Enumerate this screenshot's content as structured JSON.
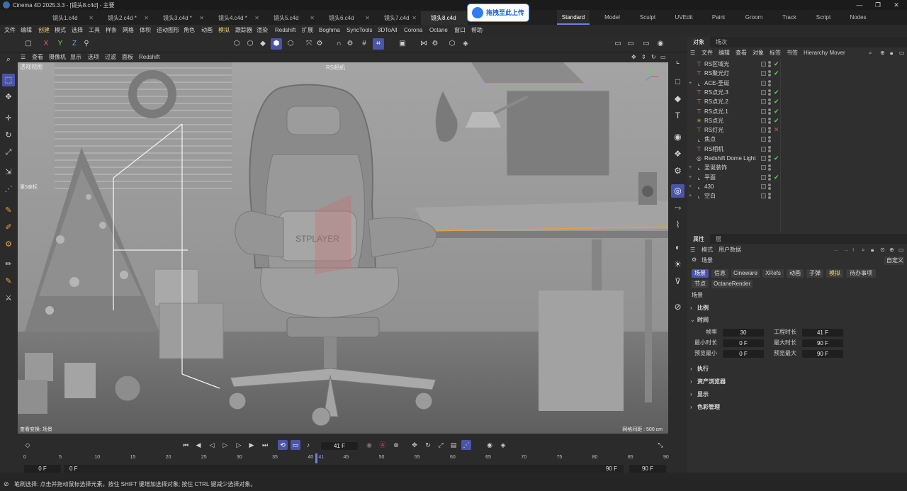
{
  "window": {
    "title": "Cinema 4D 2025.3.3 - [镜头8.c4d] - 主要"
  },
  "doc_tabs": [
    "镜头1.c4d",
    "镜头2.c4d *",
    "镜头3.c4d *",
    "镜头4.c4d *",
    "镜头5.c4d",
    "镜头6.c4d",
    "镜头7.c4d",
    "镜头8.c4d"
  ],
  "upload_button": "拖拽至此上传",
  "layout_tabs": [
    "Standard",
    "Model",
    "Sculpt",
    "UVEdit",
    "Paint",
    "Groom",
    "Track",
    "Script",
    "Nodes"
  ],
  "menus": [
    "文件",
    "编辑",
    "创建",
    "模式",
    "选择",
    "工具",
    "样条",
    "网格",
    "体积",
    "运动图形",
    "角色",
    "动画",
    "模拟",
    "跟踪器",
    "渲染",
    "Redshift",
    "扩展",
    "Boghma",
    "SyncTools",
    "3DToAll",
    "Corona",
    "Octane",
    "窗口",
    "帮助"
  ],
  "axis_buttons": [
    "X",
    "Y",
    "Z"
  ],
  "viewport": {
    "menu": [
      "查看",
      "摄像机",
      "显示",
      "选项",
      "过滤",
      "面板",
      "Redshift"
    ],
    "name": "透视视图",
    "camera": "RS相机",
    "chair_logo": "STPLAYER",
    "footer_left": "查看变换: 场景",
    "footer_right": "网格间距 : 500 cm",
    "corner_label": "第5座标"
  },
  "object_manager": {
    "tabs": [
      "对象",
      "场次"
    ],
    "menu": [
      "文件",
      "编辑",
      "查看",
      "对象",
      "标签",
      "书签",
      "Hierarchy Mover"
    ],
    "objects": [
      {
        "name": "RS区域光",
        "icon": "light",
        "status": "check",
        "expand": false
      },
      {
        "name": "RS聚光灯",
        "icon": "light",
        "status": "check",
        "expand": false
      },
      {
        "name": "ACE-圣诞",
        "icon": "null",
        "status": "",
        "expand": true
      },
      {
        "name": "RS点光.3",
        "icon": "light",
        "status": "check",
        "expand": false
      },
      {
        "name": "RS点光.2",
        "icon": "light",
        "status": "check",
        "expand": false
      },
      {
        "name": "RS点光.1",
        "icon": "light",
        "status": "check",
        "expand": false
      },
      {
        "name": "RS点光",
        "icon": "sun",
        "status": "check",
        "expand": false
      },
      {
        "name": "RS灯光",
        "icon": "light",
        "status": "cross",
        "expand": false
      },
      {
        "name": "焦点",
        "icon": "null",
        "status": "",
        "expand": false
      },
      {
        "name": "RS相机",
        "icon": "light",
        "status": "",
        "expand": false
      },
      {
        "name": "Redshift Dome Light",
        "icon": "dome",
        "status": "check",
        "expand": false
      },
      {
        "name": "圣诞装饰",
        "icon": "null",
        "status": "",
        "expand": true
      },
      {
        "name": "平面",
        "icon": "null",
        "status": "check",
        "expand": true
      },
      {
        "name": "430",
        "icon": "null",
        "status": "",
        "expand": true
      },
      {
        "name": "空白",
        "icon": "null",
        "status": "",
        "expand": true
      }
    ]
  },
  "attributes": {
    "tabs": [
      "属性",
      "层"
    ],
    "menu": [
      "模式",
      "用户数据"
    ],
    "title": "场景",
    "custom": "自定义",
    "buttons_row1": [
      "场景",
      "信息",
      "Cineware",
      "XRefs",
      "动画",
      "子弹",
      "模拟",
      "待办事项"
    ],
    "buttons_row2": [
      "节点",
      "OctaneRender"
    ],
    "section_title": "场景",
    "groups": [
      "比例",
      "时间",
      "执行",
      "资产浏览器",
      "显示",
      "色彩管理"
    ],
    "fields": [
      {
        "label": "帧率",
        "value": "30"
      },
      {
        "label": "工程时长",
        "value": "41 F"
      },
      {
        "label": "最小时长",
        "value": "0 F"
      },
      {
        "label": "最大时长",
        "value": "90 F"
      },
      {
        "label": "预览最小",
        "value": "0 F"
      },
      {
        "label": "预览最大",
        "value": "90 F"
      }
    ]
  },
  "timeline": {
    "current_frame": "41 F",
    "ticks": [
      "0",
      "5",
      "10",
      "15",
      "20",
      "25",
      "30",
      "35",
      "40",
      "45",
      "50",
      "55",
      "60",
      "65",
      "70",
      "75",
      "80",
      "85",
      "90"
    ],
    "playhead_label": "41",
    "playhead_fraction": 0.4556,
    "start": "0 F",
    "start2": "0 F",
    "end": "90 F",
    "end2": "90 F"
  },
  "status_text": "笔刷选择: 点击并拖动鼠标选择元素。按住 SHIFT 键增加选择对象; 按住 CTRL 键减少选择对象。"
}
